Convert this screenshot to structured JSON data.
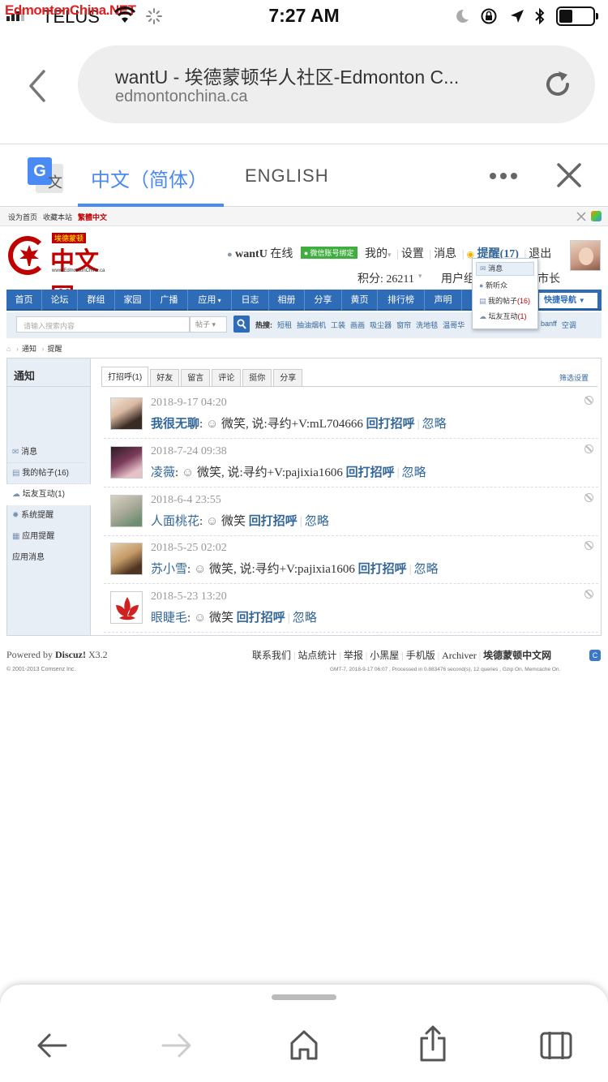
{
  "status_bar": {
    "carrier": "TELUS",
    "time": "7:27 AM",
    "site_watermark": "EdmontonChina.NET"
  },
  "url_bar": {
    "title": "wantU - 埃德蒙顿华人社区-Edmonton C...",
    "domain": "edmontonchina.ca"
  },
  "translate_bar": {
    "chinese_tab": "中文（简体）",
    "english_tab": "ENGLISH"
  },
  "topbar": {
    "set_home": "设为首页",
    "bookmark": "收藏本站",
    "traditional": "繁體中文"
  },
  "logo": {
    "banner": "埃德蒙顿",
    "name": "中文网",
    "url": "www.EdmontonChina.ca"
  },
  "user_panel": {
    "username": "wantU",
    "online": "在线",
    "wechat_bind": "微信账号绑定",
    "mine": "我的",
    "settings": "设置",
    "messages": "消息",
    "reminder": "提醒(17)",
    "logout": "退出",
    "points": "积分: 26211",
    "user_group": "用户组",
    "city_tail": "市长"
  },
  "dropdown": {
    "items": [
      {
        "label": "消息",
        "count": ""
      },
      {
        "label": "新听众",
        "count": ""
      },
      {
        "label": "我的帖子",
        "count": "(16)"
      },
      {
        "label": "坛友互动",
        "count": "(1)"
      }
    ]
  },
  "nav": {
    "items": [
      "首页",
      "论坛",
      "群组",
      "家园",
      "广播",
      "应用",
      "日志",
      "相册",
      "分享",
      "黄页",
      "排行榜",
      "声明"
    ],
    "quick_nav": "快捷导航"
  },
  "search": {
    "placeholder": "请输入搜索内容",
    "type": "帖子",
    "hot_label": "热搜:",
    "hot_terms": [
      "短租",
      "抽油烟机",
      "工装",
      "画画",
      "吸尘器",
      "窗帘",
      "洗地毯",
      "温哥华"
    ],
    "hot_terms_right": [
      "banff",
      "空调"
    ]
  },
  "breadcrumb": {
    "notice": "通知",
    "reminder": "提醒"
  },
  "sidebar": {
    "title": "通知",
    "items": [
      {
        "label": "消息"
      },
      {
        "label": "我的帖子(16)"
      },
      {
        "label": "坛友互动(1)"
      },
      {
        "label": "系统提醒"
      },
      {
        "label": "应用提醒"
      },
      {
        "label": "应用消息"
      }
    ]
  },
  "tabs": [
    "打招呼(1)",
    "好友",
    "留言",
    "评论",
    "挺你",
    "分享"
  ],
  "filter_settings": "筛选设置",
  "notices": [
    {
      "time": "2018-9-17 04:20",
      "user": "我很无聊",
      "text": "微笑, 说:寻约+V:mL704666",
      "reply": "回打招呼",
      "ignore": "忽略"
    },
    {
      "time": "2018-7-24 09:38",
      "user": "凌薇",
      "text": "微笑, 说:寻约+V:pajixia1606",
      "reply": "回打招呼",
      "ignore": "忽略"
    },
    {
      "time": "2018-6-4 23:55",
      "user": "人面桃花",
      "text": "微笑",
      "reply": "回打招呼",
      "ignore": "忽略"
    },
    {
      "time": "2018-5-25 02:02",
      "user": "苏小雪",
      "text": "微笑, 说:寻约+V:pajixia1606",
      "reply": "回打招呼",
      "ignore": "忽略"
    },
    {
      "time": "2018-5-23 13:20",
      "user": "眼睫毛",
      "text": "微笑",
      "reply": "回打招呼",
      "ignore": "忽略"
    }
  ],
  "footer": {
    "powered_by": "Powered by",
    "discuz": "Discuz!",
    "version": "X3.2",
    "copyright": "© 2001-2013 Comsenz Inc.",
    "links": [
      "联系我们",
      "站点统计",
      "举报",
      "小黑屋",
      "手机版",
      "Archiver"
    ],
    "site": "埃德蒙顿中文网",
    "stats": "GMT-7, 2018-9-17 06:07 , Processed in 0.883476 second(s), 12 queries , Gzip On, Memcache On."
  },
  "colors": {
    "nav_blue": "#2f6cb7",
    "link_blue": "#336699",
    "accent_red": "#c00000"
  }
}
